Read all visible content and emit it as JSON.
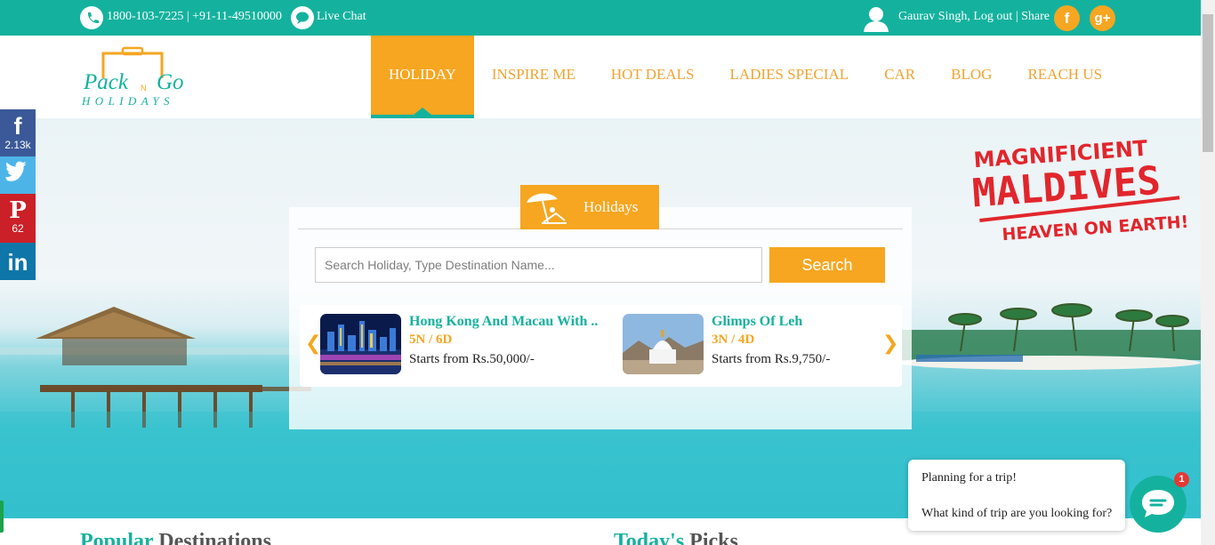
{
  "topbar": {
    "phone": "1800-103-7225 | +91-11-49510000",
    "live_chat": "Live Chat",
    "user_text": "Gaurav Singh, Log out | Share",
    "facebook_glyph": "f",
    "gplus_glyph": "g+"
  },
  "brand": {
    "logo_line1_a": "Pack",
    "logo_line1_n": "N",
    "logo_line1_b": "Go",
    "logo_line2": "HOLIDAYS",
    "colors": {
      "teal": "#14b29e",
      "orange": "#f6a620"
    }
  },
  "nav": {
    "items": [
      {
        "label": "HOLIDAY",
        "active": true
      },
      {
        "label": "INSPIRE ME"
      },
      {
        "label": "HOT DEALS"
      },
      {
        "label": "LADIES SPECIAL"
      },
      {
        "label": "CAR"
      },
      {
        "label": "BLOG"
      },
      {
        "label": "REACH US"
      }
    ]
  },
  "social_sidebar": {
    "facebook": {
      "glyph": "f",
      "count": "2.13k"
    },
    "twitter": {
      "icon": "twitter-icon"
    },
    "pinterest": {
      "glyph": "P",
      "count": "62"
    },
    "linkedin": {
      "glyph": "in"
    }
  },
  "search": {
    "tab_label": "Holidays",
    "placeholder": "Search Holiday, Type Destination Name...",
    "button_label": "Search"
  },
  "carousel": {
    "prev": "❮",
    "next": "❯",
    "packages": [
      {
        "title": "Hong Kong And Macau With ..",
        "duration": "5N / 6D",
        "price": "Starts from Rs.50,000/-"
      },
      {
        "title": "Glimps Of Leh",
        "duration": "3N / 4D",
        "price": "Starts from Rs.9,750/-"
      }
    ]
  },
  "promo": {
    "line1": "MAGNIFICIENT",
    "line2": "MALDIVES",
    "line3": "HEAVEN ON EARTH!"
  },
  "chat": {
    "line1": "Planning for a trip!",
    "line2": "What kind of trip are you looking for?",
    "badge": "1"
  },
  "sections": {
    "popular_a": "Popular",
    "popular_b": " Destinations",
    "picks_a": "Today's",
    "picks_b": " Picks"
  }
}
